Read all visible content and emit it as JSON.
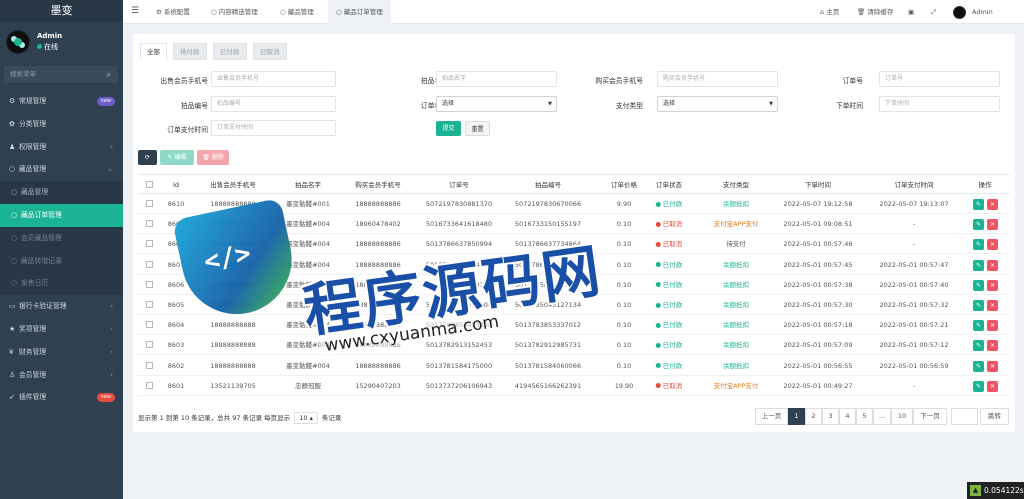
{
  "app": {
    "title": "墨变",
    "username": "Admin",
    "status": "在线"
  },
  "sidebar": {
    "search_placeholder": "搜索菜单",
    "items": [
      {
        "label": "常规管理",
        "icon": "gear-icon",
        "badge": "new",
        "badge_color": "#6c5fc7"
      },
      {
        "label": "分类管理",
        "icon": "leaf-icon"
      },
      {
        "label": "权限管理",
        "icon": "users-icon",
        "arrow": "‹"
      },
      {
        "label": "藏品管理",
        "icon": "circle-icon",
        "arrow": "⌄"
      },
      {
        "label": "藏品管理",
        "icon": "circle-icon",
        "sub": true
      },
      {
        "label": "藏品订单管理",
        "icon": "circle-icon",
        "sub": true,
        "active": true
      },
      {
        "label": "会员藏品管理",
        "icon": "circle-icon",
        "sub": true,
        "dim": true
      },
      {
        "label": "藏品转增记录",
        "icon": "circle-icon",
        "sub": true,
        "dim": true
      },
      {
        "label": "发售日历",
        "icon": "circle-icon",
        "sub": true,
        "dim": true
      },
      {
        "label": "银行卡验证管理",
        "icon": "card-icon",
        "arrow": "‹"
      },
      {
        "label": "奖项管理",
        "icon": "award-icon",
        "arrow": "‹"
      },
      {
        "label": "财务管理",
        "icon": "money-icon",
        "arrow": "‹"
      },
      {
        "label": "会员管理",
        "icon": "user-icon",
        "arrow": "‹"
      },
      {
        "label": "插件管理",
        "icon": "rocket-icon",
        "badge": "new",
        "badge_color": "#e74c3c"
      }
    ]
  },
  "topbar": {
    "tabs": [
      "系统配置",
      "内容精选管理",
      "藏品管理",
      "藏品订单管理"
    ],
    "home": "主页",
    "clear_cache": "清除缓存",
    "user": "Admin"
  },
  "filters": {
    "tabs": [
      "全部",
      "待付款",
      "已付款",
      "已取消"
    ],
    "seller_phone": {
      "label": "出售会员手机号",
      "placeholder": "出售会员手机号"
    },
    "item_name": {
      "label": "拍品名字",
      "placeholder": "拍品名字"
    },
    "buyer_phone": {
      "label": "购买会员手机号",
      "placeholder": "购买会员手机号"
    },
    "order_no": {
      "label": "订单号",
      "placeholder": "订单号"
    },
    "item_no": {
      "label": "拍品编号",
      "placeholder": "拍品编号"
    },
    "order_status": {
      "label": "订单状态",
      "value": "选择"
    },
    "pay_type": {
      "label": "支付类型",
      "value": "选择"
    },
    "order_time": {
      "label": "下单时间",
      "placeholder": "下单时间"
    },
    "pay_time": {
      "label": "订单支付时间",
      "placeholder": "订单支付时间"
    },
    "submit": "提交",
    "reset": "重置"
  },
  "toolbar": {
    "refresh_icon": "refresh-icon",
    "edit": "编辑",
    "delete": "删除"
  },
  "table": {
    "headers": [
      "Id",
      "出售会员手机号",
      "拍品名字",
      "购买会员手机号",
      "订单号",
      "拍品编号",
      "订单价格",
      "订单状态",
      "支付类型",
      "下单时间",
      "订单支付时间",
      "操作"
    ],
    "rows": [
      {
        "id": "8610",
        "seller": "18888888888",
        "name": "墨变骷髅#001",
        "buyer": "18888888886",
        "order": "5072197830881370",
        "item": "5072197830670066",
        "price": "9.90",
        "status": "已付款",
        "status_color": "#1ab394",
        "pay": "余额抵扣",
        "pay_color": "#1ab394",
        "time": "2022-05-07 19:12:58",
        "paid": "2022-05-07 19:13:07"
      },
      {
        "id": "8609",
        "seller": "18888888888",
        "name": "墨变骷髅#004",
        "buyer": "18960478402",
        "order": "5016733641618480",
        "item": "5016733150155197",
        "price": "0.10",
        "status": "已取消",
        "status_color": "#e74c3c",
        "pay": "支付宝APP支付",
        "pay_color": "#e67e22",
        "time": "2022-05-01 09:08:51",
        "paid": "-"
      },
      {
        "id": "8608",
        "seller": "18888888888",
        "name": "墨变骷髅#004",
        "buyer": "18888888886",
        "order": "5013786637850994",
        "item": "5013786637734864",
        "price": "0.10",
        "status": "已取消",
        "status_color": "#e74c3c",
        "pay": "待支付",
        "pay_color": "#555555",
        "time": "2022-05-01 00:57:46",
        "paid": "-"
      },
      {
        "id": "8607",
        "seller": "18888888888",
        "name": "墨变骷髅#004",
        "buyer": "18888888886",
        "order": "5013786522094616",
        "item": "5013786521982259",
        "price": "0.10",
        "status": "已付款",
        "status_color": "#1ab394",
        "pay": "余额抵扣",
        "pay_color": "#1ab394",
        "time": "2022-05-01 00:57:45",
        "paid": "2022-05-01 00:57:47"
      },
      {
        "id": "8606",
        "seller": "18888888888",
        "name": "墨变骷髅#004",
        "buyer": "18888888886",
        "order": "5013785806153361",
        "item": "5013785806033695",
        "price": "0.10",
        "status": "已付款",
        "status_color": "#1ab394",
        "pay": "余额抵扣",
        "pay_color": "#1ab394",
        "time": "2022-05-01 00:57:38",
        "paid": "2022-05-01 00:57:40"
      },
      {
        "id": "8605",
        "seller": "18888888888",
        "name": "墨变骷髅#004",
        "buyer": "18888888886",
        "order": "5013785045243000",
        "item": "5013785045127134",
        "price": "0.10",
        "status": "已付款",
        "status_color": "#1ab394",
        "pay": "余额抵扣",
        "pay_color": "#1ab394",
        "time": "2022-05-01 00:57:30",
        "paid": "2022-05-01 00:57:32"
      },
      {
        "id": "8604",
        "seller": "18888888888",
        "name": "墨变骷髅#004",
        "buyer": "18888888886",
        "order": "5013783853453000",
        "item": "5013783853337012",
        "price": "0.10",
        "status": "已付款",
        "status_color": "#1ab394",
        "pay": "余额抵扣",
        "pay_color": "#1ab394",
        "time": "2022-05-01 00:57:18",
        "paid": "2022-05-01 00:57:21"
      },
      {
        "id": "8603",
        "seller": "18888888888",
        "name": "墨变骷髅#004",
        "buyer": "18888888886",
        "order": "5013782913152453",
        "item": "5013782912985731",
        "price": "0.10",
        "status": "已付款",
        "status_color": "#1ab394",
        "pay": "余额抵扣",
        "pay_color": "#1ab394",
        "time": "2022-05-01 00:57:09",
        "paid": "2022-05-01 00:57:12"
      },
      {
        "id": "8602",
        "seller": "18888888888",
        "name": "墨变骷髅#004",
        "buyer": "18888888886",
        "order": "5013781584175000",
        "item": "5013781584060066",
        "price": "0.10",
        "status": "已付款",
        "status_color": "#1ab394",
        "pay": "余额抵扣",
        "pay_color": "#1ab394",
        "time": "2022-05-01 00:56:55",
        "paid": "2022-05-01 00:56:59"
      },
      {
        "id": "8601",
        "seller": "13521139705",
        "name": "忠静冠服",
        "buyer": "15290407203",
        "order": "5013737206106943",
        "item": "4194565166262391",
        "price": "19.90",
        "status": "已取消",
        "status_color": "#e74c3c",
        "pay": "支付宝APP支付",
        "pay_color": "#e67e22",
        "time": "2022-05-01 00:49:27",
        "paid": "-"
      }
    ]
  },
  "footer": {
    "summary_prefix": "显示第 1 到第 10 条记录，总共 97 条记录 每页显示",
    "page_size": "10",
    "summary_suffix": "条记录",
    "prev": "上一页",
    "pages": [
      "1",
      "2",
      "3",
      "4",
      "5",
      "...",
      "10"
    ],
    "next": "下一页",
    "goto": "跳转"
  },
  "watermark": {
    "icon_text": "</>",
    "text": "程序源码网",
    "url": "www.cxyuanma.com"
  },
  "timer": "0.054122s",
  "colors": {
    "sidebar": "#2f4050",
    "accent": "#1ab394",
    "danger": "#e74c3c",
    "edit": "#1ab394",
    "delete": "#ed5565"
  }
}
